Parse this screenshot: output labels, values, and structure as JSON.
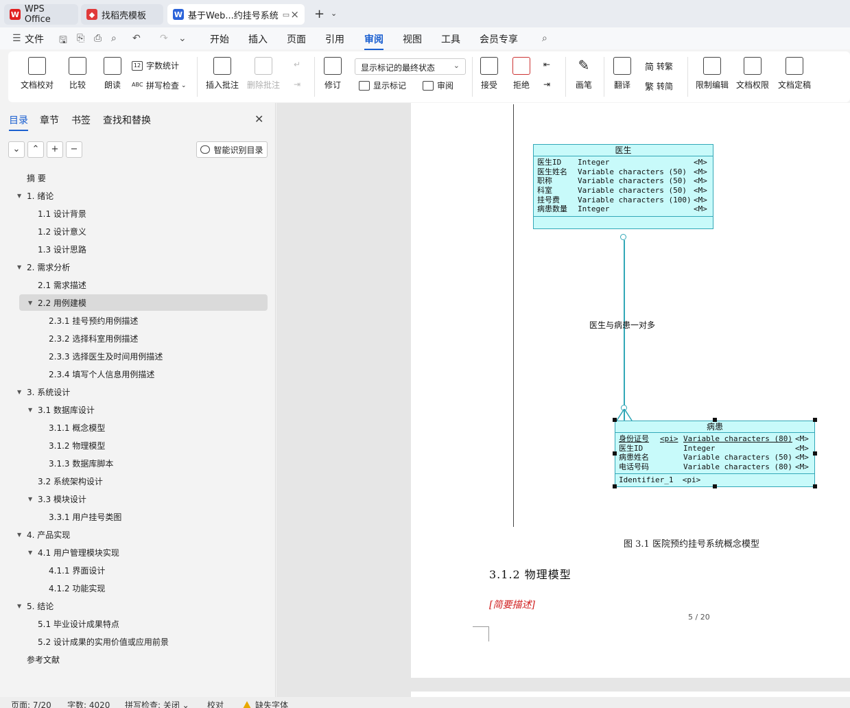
{
  "tabs": [
    {
      "label": "WPS Office"
    },
    {
      "label": "找稻壳模板"
    },
    {
      "label": "基于Web...约挂号系统"
    }
  ],
  "menu": {
    "file": "文件",
    "items": [
      "开始",
      "插入",
      "页面",
      "引用",
      "审阅",
      "视图",
      "工具",
      "会员专享"
    ],
    "active": "审阅"
  },
  "ribbon": {
    "doc_check": "文档校对",
    "compare": "比较",
    "read_aloud": "朗读",
    "word_count": "字数统计",
    "spell_check": "拼写检查",
    "insert_comment": "插入批注",
    "delete_comment": "删除批注",
    "track_changes": "修订",
    "markup_select": "显示标记的最终状态",
    "show_markup": "显示标记",
    "review": "审阅",
    "accept": "接受",
    "reject": "拒绝",
    "pen": "画笔",
    "translate": "翻译",
    "to_traditional": "转繁",
    "to_simplified": "转简",
    "restrict_edit": "限制编辑",
    "doc_permission": "文档权限",
    "doc_finalize": "文档定稿"
  },
  "nav": {
    "tabs": [
      "目录",
      "章节",
      "书签",
      "查找和替换"
    ],
    "smart_button": "智能识别目录",
    "toc": [
      {
        "label": "摘  要"
      },
      {
        "label": "1.  绪论"
      },
      {
        "label": "1.1 设计背景"
      },
      {
        "label": "1.2 设计意义"
      },
      {
        "label": "1.3 设计思路"
      },
      {
        "label": "2.  需求分析"
      },
      {
        "label": "2.1  需求描述"
      },
      {
        "label": "2.2  用例建模"
      },
      {
        "label": "2.3.1  挂号预约用例描述"
      },
      {
        "label": "2.3.2 选择科室用例描述"
      },
      {
        "label": "2.3.3  选择医生及时间用例描述"
      },
      {
        "label": "2.3.4  填写个人信息用例描述"
      },
      {
        "label": "3.  系统设计"
      },
      {
        "label": "3.1  数据库设计"
      },
      {
        "label": "3.1.1  概念模型"
      },
      {
        "label": "3.1.2  物理模型"
      },
      {
        "label": "3.1.3  数据库脚本"
      },
      {
        "label": "3.2  系统架构设计"
      },
      {
        "label": "3.3  模块设计"
      },
      {
        "label": "3.3.1 用户挂号类图"
      },
      {
        "label": "4.  产品实现"
      },
      {
        "label": "4.1  用户管理模块实现"
      },
      {
        "label": "4.1.1  界面设计"
      },
      {
        "label": "4.1.2  功能实现"
      },
      {
        "label": "5.  结论"
      },
      {
        "label": "5.1 毕业设计成果特点"
      },
      {
        "label": "5.2 设计成果的实用价值或应用前景"
      },
      {
        "label": "参考文献"
      }
    ]
  },
  "diagram": {
    "doctor": {
      "title": "医生",
      "rows": [
        {
          "name": "医生ID",
          "type": "Integer",
          "m": "<M>"
        },
        {
          "name": "医生姓名",
          "type": "Variable characters (50)",
          "m": "<M>"
        },
        {
          "name": "职称",
          "type": "Variable characters (50)",
          "m": "<M>"
        },
        {
          "name": "科室",
          "type": "Variable characters (50)",
          "m": "<M>"
        },
        {
          "name": "挂号费",
          "type": "Variable characters (100)",
          "m": "<M>"
        },
        {
          "name": "病患数量",
          "type": "Integer",
          "m": "<M>"
        }
      ]
    },
    "patient": {
      "title": "病患",
      "rows": [
        {
          "name": "身份证号",
          "pi": "<pi>",
          "type": "Variable characters (80)",
          "m": "<M>"
        },
        {
          "name": "医生ID",
          "pi": "",
          "type": "Integer",
          "m": "<M>"
        },
        {
          "name": "病患姓名",
          "pi": "",
          "type": "Variable characters (50)",
          "m": "<M>"
        },
        {
          "name": "电话号码",
          "pi": "",
          "type": "Variable characters (80)",
          "m": "<M>"
        }
      ],
      "identifier": "Identifier_1  <pi>"
    },
    "relationship": "医生与病患一对多"
  },
  "doc": {
    "caption": "图 3.1  医院预约挂号系统概念模型",
    "heading": "3.1.2  物理模型",
    "brief": "[简要描述]",
    "page_number": "5 / 20"
  },
  "status": {
    "page": "页面: 7/20",
    "words": "字数: 4020",
    "spell": "拼写检查: 关闭",
    "proof": "校对",
    "missing_font": "缺失字体"
  }
}
